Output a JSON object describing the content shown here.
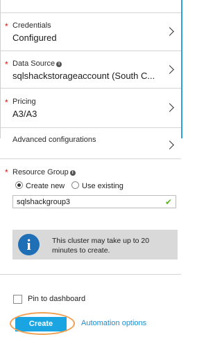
{
  "fields": {
    "credentials": {
      "label": "Credentials",
      "value": "Configured"
    },
    "data_source": {
      "label": "Data Source",
      "value": "sqlshackstorageaccount (South C..."
    },
    "pricing": {
      "label": "Pricing",
      "value": "A3/A3"
    },
    "advanced": {
      "label": "Advanced configurations"
    }
  },
  "resource_group": {
    "label": "Resource Group",
    "options": {
      "create_new": "Create new",
      "use_existing": "Use existing"
    },
    "selected": "Create new",
    "input_value": "sqlshackgroup3"
  },
  "info": {
    "icon_letter": "i",
    "message": "This cluster may take up to 20 minutes to create."
  },
  "footer": {
    "pin_label": "Pin to dashboard",
    "create_label": "Create",
    "automation_label": "Automation options"
  },
  "colors": {
    "accent": "#1aa5e2",
    "required": "#e00b0b",
    "info_icon": "#1e6fb5",
    "highlight": "#f0a050",
    "valid_check": "#5fb12a"
  }
}
